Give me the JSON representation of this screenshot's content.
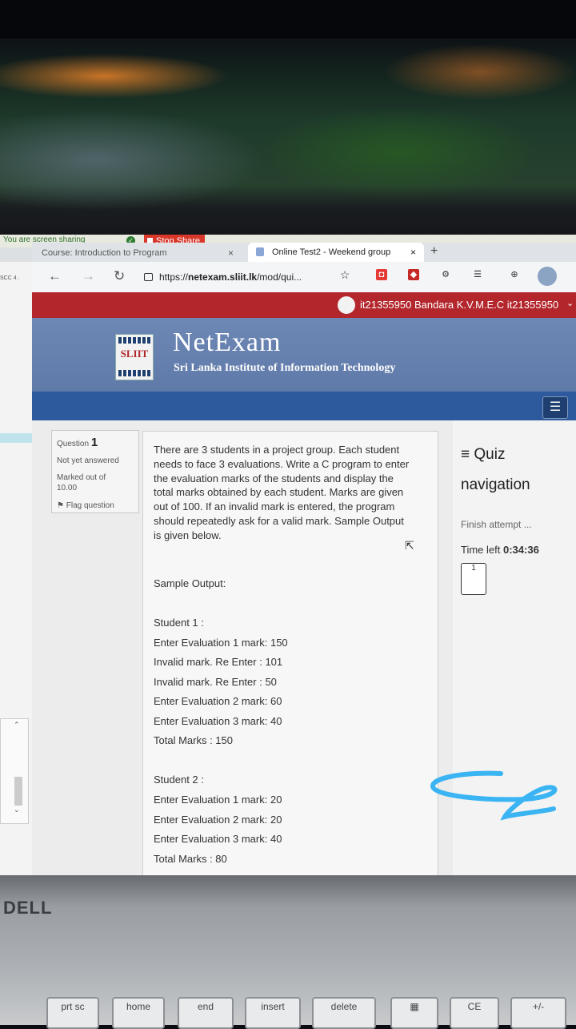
{
  "share_bar": {
    "message": "You are screen sharing",
    "stop_label": "Stop Share"
  },
  "left_app": {
    "label": "SCC 4 ."
  },
  "tabs": [
    {
      "title": "Course: Introduction to Program"
    },
    {
      "title": "Online Test2 - Weekend group"
    }
  ],
  "browser": {
    "url_prefix": "https://",
    "url_domain": "netexam.sliit.lk",
    "url_rest": "/mod/qui..."
  },
  "user": {
    "name": "it21355950 Bandara K.V.M.E.C it21355950"
  },
  "site": {
    "logo_text": "SLIIT",
    "title": "NetExam",
    "subtitle": "Sri Lanka Institute of Information Technology"
  },
  "question_info": {
    "question_label": "Question",
    "question_number": "1",
    "status": "Not yet answered",
    "marked_out_of": "Marked out of",
    "max_mark": "10.00",
    "flag_label": "Flag question"
  },
  "question": {
    "text": "There are 3 students in a project group. Each student needs to face 3 evaluations. Write a C program to enter the evaluation marks of the students and display the total marks obtained by each student. Marks are given out of 100. If an invalid mark is entered, the program should repeatedly ask for a valid mark. Sample Output is given below.",
    "sample_heading": "Sample Output:",
    "sample_lines": [
      "Student 1 :",
      "Enter Evaluation 1 mark:  150",
      "Invalid mark. Re Enter : 101",
      "Invalid mark. Re Enter : 50",
      "Enter Evaluation 2 mark:  60",
      "Enter Evaluation 3 mark:  40",
      "Total Marks : 150",
      "Student 2 :",
      "Enter Evaluation 1 mark:  20",
      "Enter Evaluation 2 mark:  20",
      "Enter Evaluation 3 mark:  40",
      "Total Marks : 80"
    ]
  },
  "quiz_nav": {
    "title": "Quiz navigation",
    "finish": "Finish attempt ...",
    "time_label": "Time left",
    "time_value": "0:34:36",
    "question_buttons": [
      "1"
    ]
  },
  "laptop": {
    "brand": "DELL",
    "keys": [
      "prt sc",
      "home",
      "end",
      "insert",
      "delete",
      "CE",
      "+/-"
    ]
  },
  "colors": {
    "user_bar": "#b3262c",
    "banner": "#6e88b6",
    "navbar": "#2d5a9c",
    "annotation": "#3ab4f2"
  }
}
